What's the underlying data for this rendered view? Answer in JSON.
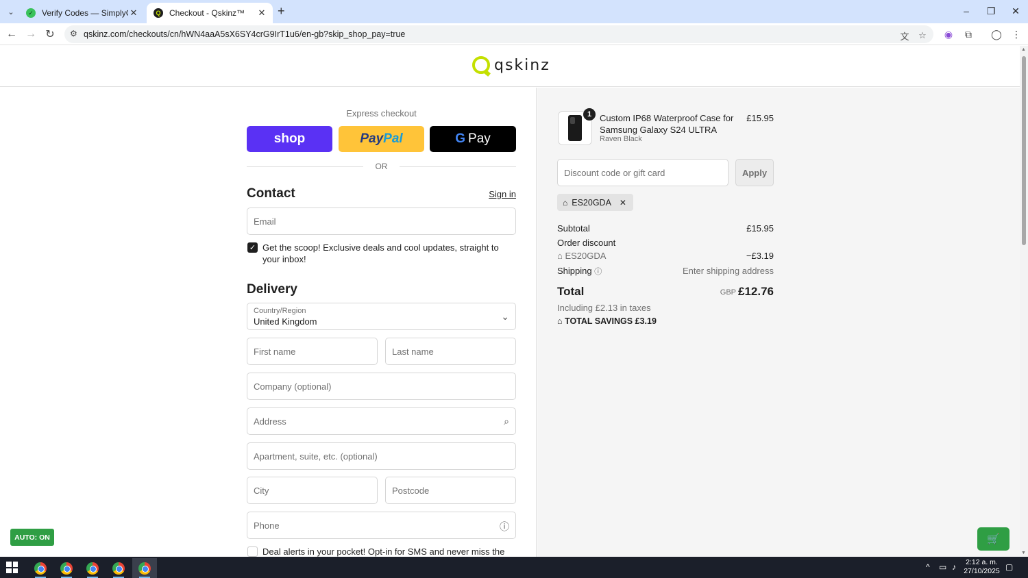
{
  "browser": {
    "tabs": [
      {
        "title": "Verify Codes — SimplyCodes"
      },
      {
        "title": "Checkout - Qskinz™"
      }
    ],
    "url": "qskinz.com/checkouts/cn/hWN4aaA5sX6SY4crG9IrT1u6/en-gb?skip_shop_pay=true"
  },
  "header": {
    "logo_text": "qskinz"
  },
  "express": {
    "label": "Express checkout",
    "shop": "shop",
    "paypal_1": "Pay",
    "paypal_2": "Pal",
    "gpay_g": "G",
    "gpay_text": "Pay",
    "or": "OR"
  },
  "contact": {
    "title": "Contact",
    "signin": "Sign in",
    "email_placeholder": "Email",
    "newsletter_text": "Get the scoop! Exclusive deals and cool updates, straight to your inbox!"
  },
  "delivery": {
    "title": "Delivery",
    "country_label": "Country/Region",
    "country_value": "United Kingdom",
    "first_name": "First name",
    "last_name": "Last name",
    "company": "Company (optional)",
    "address": "Address",
    "apartment": "Apartment, suite, etc. (optional)",
    "city": "City",
    "postcode": "Postcode",
    "phone": "Phone",
    "sms_text": "Deal alerts in your pocket! Opt-in for SMS and never miss the VIP"
  },
  "summary": {
    "quantity": "1",
    "product_name": "Custom IP68 Waterproof Case for Samsung Galaxy S24 ULTRA",
    "variant": "Raven Black",
    "product_price": "£15.95",
    "discount_placeholder": "Discount code or gift card",
    "apply": "Apply",
    "applied_code": "ES20GDA",
    "subtotal_label": "Subtotal",
    "subtotal_value": "£15.95",
    "order_discount_label": "Order discount",
    "discount_code": "ES20GDA",
    "discount_value": "−£3.19",
    "shipping_label": "Shipping",
    "shipping_value": "Enter shipping address",
    "total_label": "Total",
    "currency": "GBP",
    "total_value": "£12.76",
    "taxes": "Including £2.13 in taxes",
    "savings_label": "TOTAL SAVINGS",
    "savings_value": "£3.19"
  },
  "extension": {
    "auto_label": "AUTO: ON"
  },
  "taskbar": {
    "time": "2:12 a. m.",
    "date": "27/10/2025"
  }
}
